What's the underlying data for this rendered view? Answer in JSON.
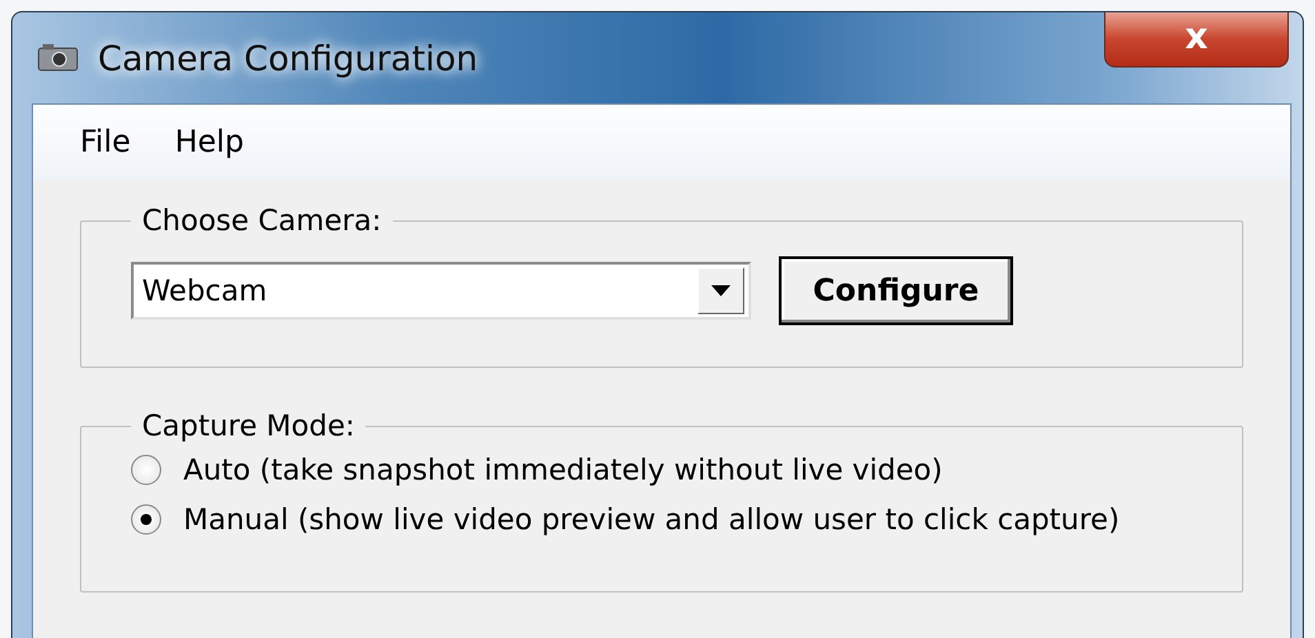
{
  "window": {
    "title": "Camera Configuration",
    "close_label": "x"
  },
  "menu": [
    {
      "label": "File"
    },
    {
      "label": "Help"
    }
  ],
  "camera_group": {
    "label": "Choose Camera:",
    "value": "Webcam",
    "button": "Configure"
  },
  "capture_group": {
    "label": "Capture Mode:",
    "options": [
      {
        "label": "Auto (take snapshot immediately without live video)",
        "selected": false
      },
      {
        "label": "Manual (show live video preview and allow user to click capture)",
        "selected": true
      }
    ]
  }
}
